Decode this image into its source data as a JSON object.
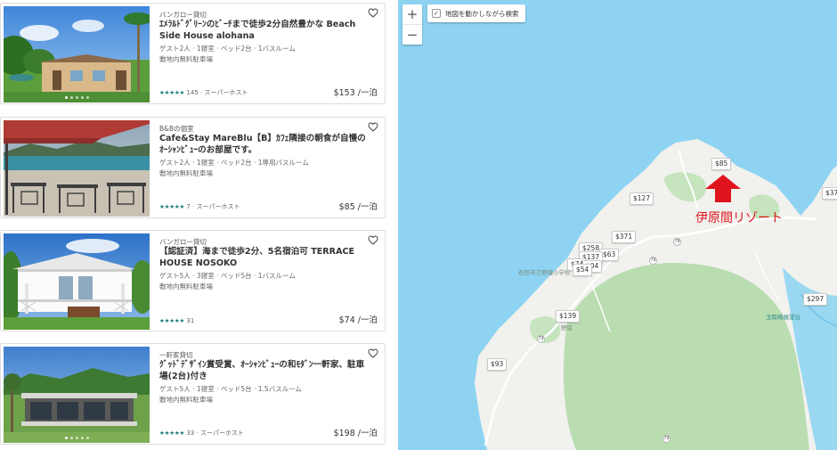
{
  "listings": [
    {
      "category": "バンガロー貸切",
      "title": "ｴﾒﾗﾙﾄﾞｸﾞﾘｰﾝのﾋﾞｰﾁまで徒歩2分自然豊かな Beach Side House alohana",
      "specs": "ゲスト2人 · 1寝室 · ベッド2台 · 1バスルーム",
      "amenity": "敷地内無料駐車場",
      "stars": "★★★★★",
      "reviews": "145",
      "host_badge": "· スーパーホスト",
      "price": "$153 /一泊"
    },
    {
      "category": "B&Bの個室",
      "title": "Cafe&Stay MareBlu【B】ｶﾌｪ隣接の朝食が自慢のｵｰｼｬﾝﾋﾞｭｰのお部屋です。",
      "specs": "ゲスト2人 · 1寝室 · ベッド2台 · 1専用バスルーム",
      "amenity": "敷地内無料駐車場",
      "stars": "★★★★★",
      "reviews": "7",
      "host_badge": "· スーパーホスト",
      "price": "$85 /一泊"
    },
    {
      "category": "バンガロー貸切",
      "title": "【認証済】海まで徒歩2分、5名宿泊可 TERRACE HOUSE NOSOKO",
      "specs": "ゲスト5人 · 3寝室 · ベッド5台 · 1バスルーム",
      "amenity": "敷地内無料駐車場",
      "stars": "★★★★★",
      "reviews": "31",
      "host_badge": "",
      "price": "$74 /一泊"
    },
    {
      "category": "一軒家貸切",
      "title": "ｸﾞｯﾄﾞﾃﾞｻﾞｲﾝ賞受賞、ｵｰｼｬﾝﾋﾞｭｰの和ﾓﾀﾞﾝ一軒家、駐車場(2台)付き",
      "specs": "ゲスト5人 · 1寝室 · ベッド5台 · 1.5バスルーム",
      "amenity": "敷地内無料駐車場",
      "stars": "★★★★★",
      "reviews": "33",
      "host_badge": "· スーパーホスト",
      "price": "$198 /一泊"
    }
  ],
  "map": {
    "zoom_in": "+",
    "zoom_out": "−",
    "move_search_label": "地図を動かしながら検索",
    "move_search_checked": true,
    "pins": [
      "$85",
      "$127",
      "$371",
      "$258",
      "$63",
      "$137",
      "$74",
      "$04",
      "$54",
      "$139",
      "$93",
      "$297",
      "$37"
    ],
    "places": [
      "石垣市江野城小学校",
      "野底",
      "玉取崎展望台"
    ],
    "road_numbers": [
      "79",
      "79",
      "79",
      "79"
    ],
    "annotation": "伊原間リゾート",
    "colors": {
      "sea": "#8ed3f2",
      "land": "#f1f1ee",
      "forest": "#b9ddb1",
      "annotation_red": "#e0141c",
      "star_teal": "#1b7a7a"
    }
  }
}
